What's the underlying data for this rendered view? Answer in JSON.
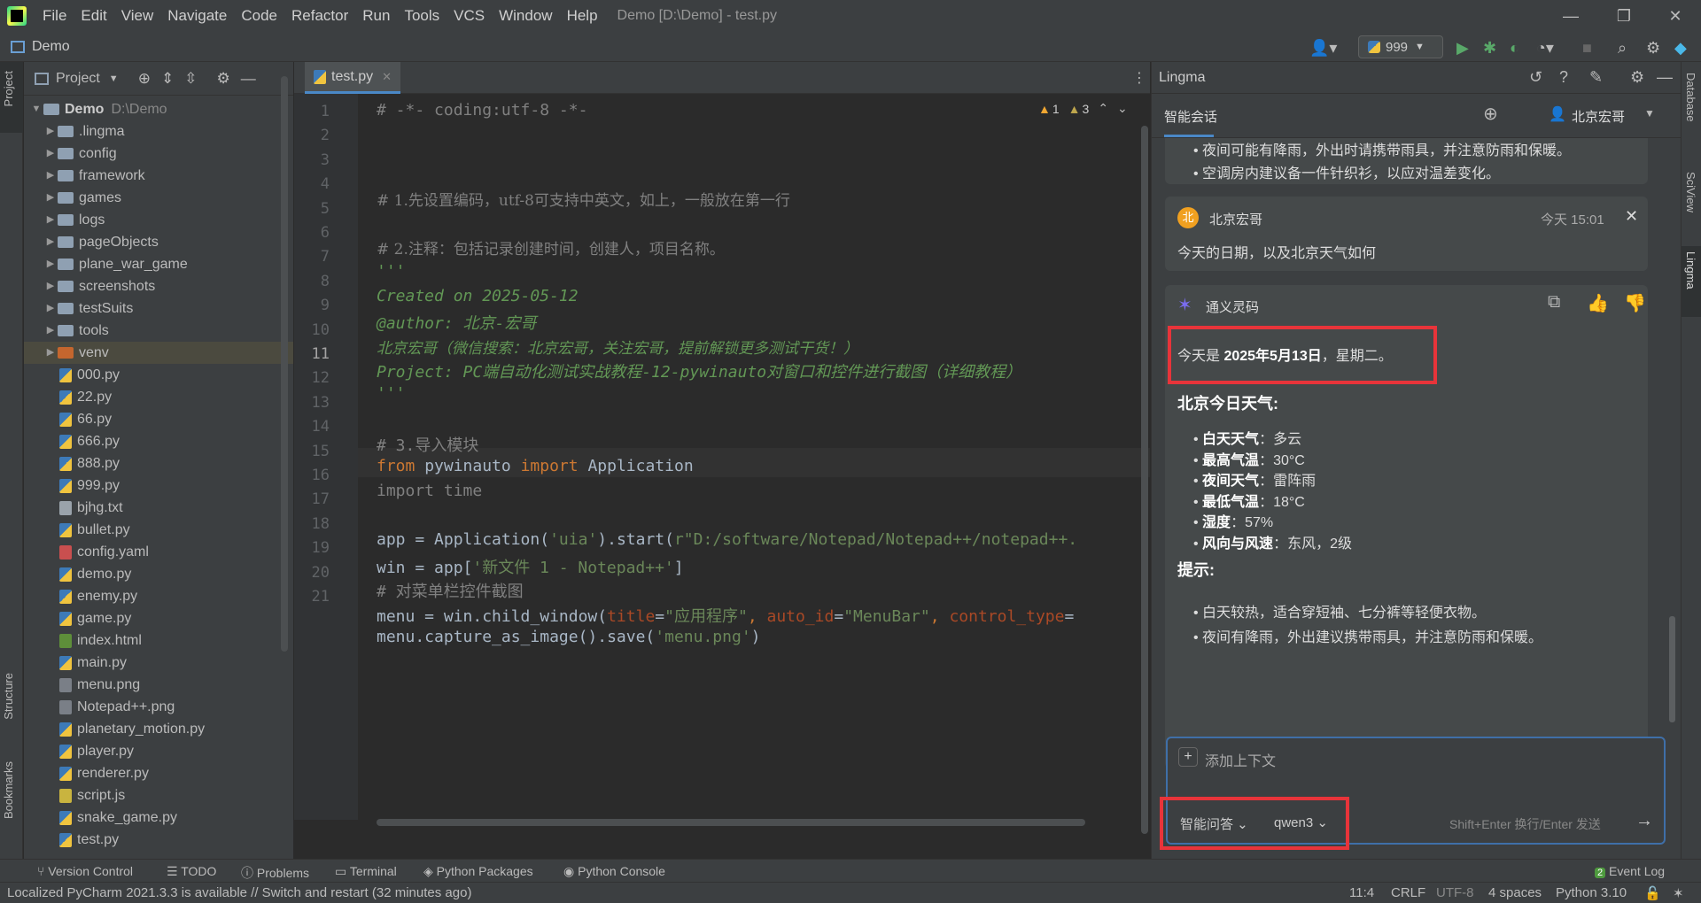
{
  "menubar": {
    "items": [
      "File",
      "Edit",
      "View",
      "Navigate",
      "Code",
      "Refactor",
      "Run",
      "Tools",
      "VCS",
      "Window",
      "Help"
    ],
    "window_title": "Demo [D:\\Demo] - test.py"
  },
  "navbar": {
    "project": "Demo",
    "run_config": "999"
  },
  "left_strip": {
    "project_tab": "Project",
    "structure_tab": "Structure",
    "bookmarks_tab": "Bookmarks"
  },
  "project_panel": {
    "title": "Project",
    "root": {
      "name": "Demo",
      "path": "D:\\Demo"
    },
    "folders": [
      ".lingma",
      "config",
      "framework",
      "games",
      "logs",
      "pageObjects",
      "plane_war_game",
      "screenshots",
      "testSuits",
      "tools",
      "venv"
    ],
    "files": [
      {
        "name": "000.py",
        "type": "py"
      },
      {
        "name": "22.py",
        "type": "py"
      },
      {
        "name": "66.py",
        "type": "py"
      },
      {
        "name": "666.py",
        "type": "py"
      },
      {
        "name": "888.py",
        "type": "py"
      },
      {
        "name": "999.py",
        "type": "py"
      },
      {
        "name": "bjhg.txt",
        "type": "txt"
      },
      {
        "name": "bullet.py",
        "type": "py"
      },
      {
        "name": "config.yaml",
        "type": "yml"
      },
      {
        "name": "demo.py",
        "type": "py"
      },
      {
        "name": "enemy.py",
        "type": "py"
      },
      {
        "name": "game.py",
        "type": "py"
      },
      {
        "name": "index.html",
        "type": "html"
      },
      {
        "name": "main.py",
        "type": "py"
      },
      {
        "name": "menu.png",
        "type": "png"
      },
      {
        "name": "Notepad++.png",
        "type": "png"
      },
      {
        "name": "planetary_motion.py",
        "type": "py"
      },
      {
        "name": "player.py",
        "type": "py"
      },
      {
        "name": "renderer.py",
        "type": "py"
      },
      {
        "name": "script.js",
        "type": "js"
      },
      {
        "name": "snake_game.py",
        "type": "py"
      },
      {
        "name": "test.py",
        "type": "py"
      }
    ]
  },
  "editor": {
    "tab": "test.py",
    "warnings": "1",
    "weak_warnings": "3",
    "line_numbers": [
      "1",
      "2",
      "3",
      "4",
      "5",
      "6",
      "7",
      "8",
      "9",
      "10",
      "11",
      "12",
      "13",
      "14",
      "15",
      "16",
      "17",
      "18",
      "19",
      "20",
      "21"
    ],
    "lines": {
      "l1": "# -*- coding:utf-8 -*-",
      "l3": "# 1.先设置编码，utf-8可支持中英文，如上，一般放在第一行",
      "l5": "# 2.注释：包括记录创建时间，创建人，项目名称。",
      "l6": "'''",
      "l7": "Created on 2025-05-12",
      "l8": "@author: 北京-宏哥",
      "l9": "北京宏哥（微信搜索：北京宏哥，关注宏哥，提前解锁更多测试干货！）",
      "l10": "Project: PC端自动化测试实战教程-12-pywinauto对窗口和控件进行截图（详细教程）",
      "l11": "'''",
      "l13": "# 3.导入模块",
      "l14_from": "from",
      "l14_mod": " pywinauto ",
      "l14_import": "import",
      "l14_name": " Application",
      "l15": "import time",
      "l17_a": "app = Application(",
      "l17_s1": "'uia'",
      "l17_b": ").start(",
      "l17_s2": "r\"D:/software/Notepad/Notepad++/notepad++.",
      "l18_a": "win = app[",
      "l18_s": "'新文件 1 - Notepad++'",
      "l18_b": "]",
      "l19": "# 对菜单栏控件截图",
      "l20_a": "menu = win.child_window(",
      "l20_p1": "title",
      "l20_eq1": "=",
      "l20_s1": "\"应用程序\"",
      "l20_c1": ", ",
      "l20_p2": "auto_id",
      "l20_eq2": "=",
      "l20_s2": "\"MenuBar\"",
      "l20_c2": ", ",
      "l20_p3": "control_type",
      "l20_eq3": "=",
      "l21_a": "menu.capture_as_image().save(",
      "l21_s": "'menu.png'",
      "l21_b": ")"
    }
  },
  "lingma": {
    "title": "Lingma",
    "tab": "智能会话",
    "user_name": "北京宏哥",
    "prev_tips": [
      "夜间可能有降雨，外出时请携带雨具，并注意防雨和保暖。",
      "空调房内建议备一件针织衫，以应对温差变化。"
    ],
    "user_msg": {
      "avatar": "北",
      "name": "北京宏哥",
      "time": "今天 15:01",
      "text": "今天的日期，以及北京天气如何"
    },
    "bot": {
      "name": "通义灵码",
      "date_prefix": "今天是 ",
      "date_bold": "2025年5月13日",
      "date_suffix": "，星期二。",
      "weather_heading": "北京今日天气:",
      "weather": [
        {
          "label": "白天天气",
          "value": "：多云"
        },
        {
          "label": "最高气温",
          "value": "：30°C"
        },
        {
          "label": "夜间天气",
          "value": "：雷阵雨"
        },
        {
          "label": "最低气温",
          "value": "：18°C"
        },
        {
          "label": "湿度",
          "value": "：57%"
        },
        {
          "label": "风向与风速",
          "value": "：东风，2级"
        }
      ],
      "tips_heading": "提示:",
      "tips": [
        "白天较热，适合穿短袖、七分裤等轻便衣物。",
        "夜间有降雨，外出建议携带雨具，并注意防雨和保暖。"
      ]
    },
    "input": {
      "add_context": "添加上下文",
      "mode": "智能问答",
      "model": "qwen3",
      "hint": "Shift+Enter 换行/Enter 发送"
    }
  },
  "right_strip": {
    "database": "Database",
    "sciview": "SciView",
    "lingma": "Lingma"
  },
  "bottom_tools": {
    "vcs": "Version Control",
    "todo": "TODO",
    "problems": "Problems",
    "terminal": "Terminal",
    "packages": "Python Packages",
    "console": "Python Console",
    "event_count": "2",
    "event_log": "Event Log"
  },
  "status": {
    "message": "Localized PyCharm 2021.3.3 is available // Switch and restart (32 minutes ago)",
    "position": "11:4",
    "line_sep": "CRLF",
    "encoding": "UTF-8",
    "indent": "4 spaces",
    "interpreter": "Python 3.10"
  }
}
